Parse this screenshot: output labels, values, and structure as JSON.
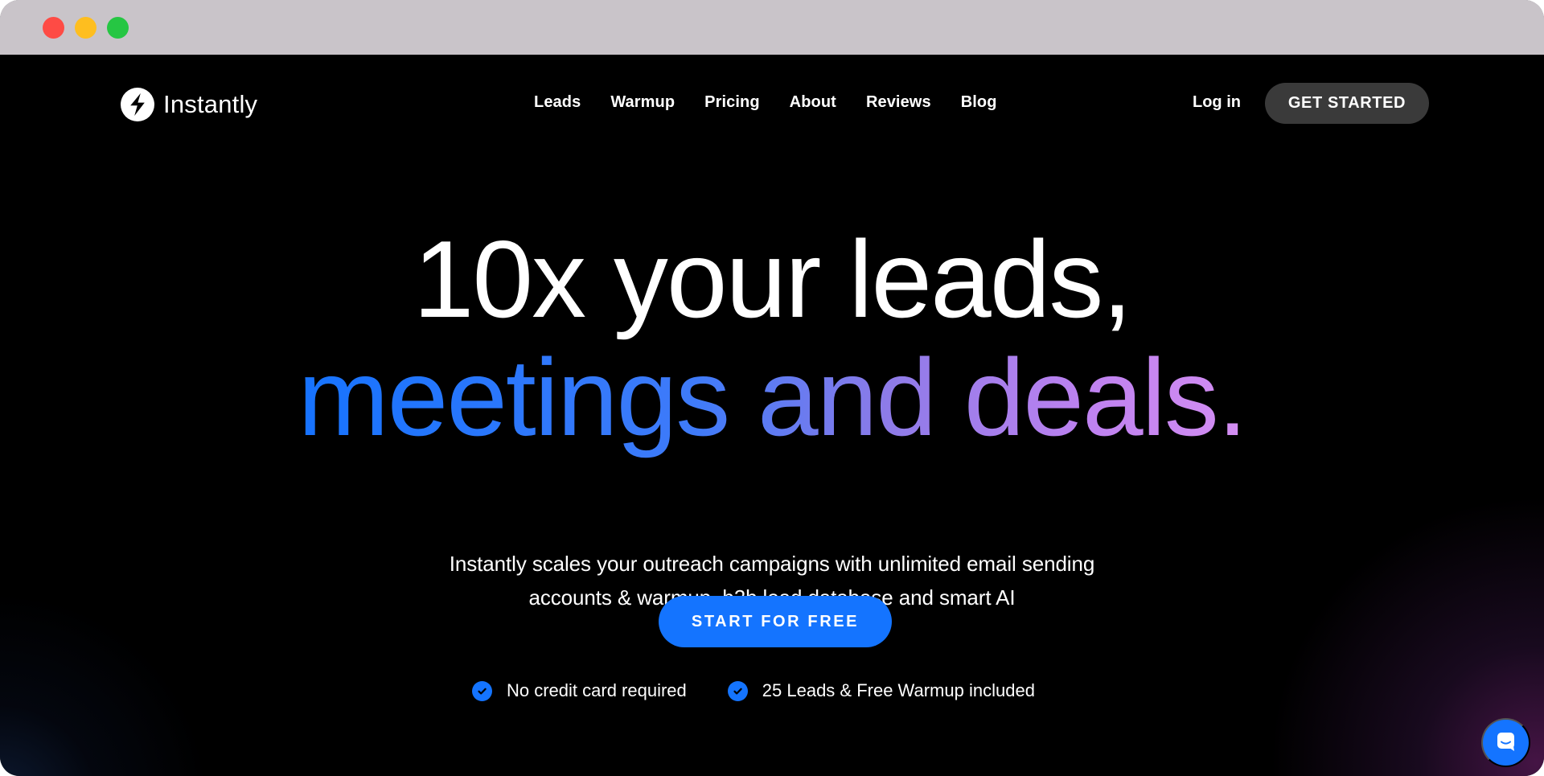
{
  "window": {
    "controls": {
      "close": "close",
      "minimize": "minimize",
      "zoom": "zoom"
    }
  },
  "header": {
    "brand": {
      "name": "Instantly",
      "icon": "lightning-bolt-icon"
    },
    "nav": [
      {
        "label": "Leads"
      },
      {
        "label": "Warmup"
      },
      {
        "label": "Pricing"
      },
      {
        "label": "About"
      },
      {
        "label": "Reviews"
      },
      {
        "label": "Blog"
      }
    ],
    "login_label": "Log in",
    "cta_label": "GET STARTED"
  },
  "hero": {
    "headline_line_1": "10x your leads,",
    "headline_line_2": "meetings and deals.",
    "subtitle_line_1": "Instantly scales your outreach campaigns with unlimited email sending",
    "subtitle_line_2": "accounts & warmup, b2b lead database and smart AI",
    "primary_cta": "START FOR FREE",
    "benefits": [
      {
        "label": "No credit card required",
        "icon": "check-circle-icon"
      },
      {
        "label": "25 Leads & Free Warmup included",
        "icon": "check-circle-icon"
      }
    ]
  },
  "chat": {
    "icon": "chat-bubble-icon"
  },
  "colors": {
    "background": "#000000",
    "titlebar": "#c9c4c9",
    "accent_blue": "#1474ff",
    "button_dark": "#3a3a3a",
    "gradient_start": "#1673ff",
    "gradient_end": "#d48ef2"
  }
}
